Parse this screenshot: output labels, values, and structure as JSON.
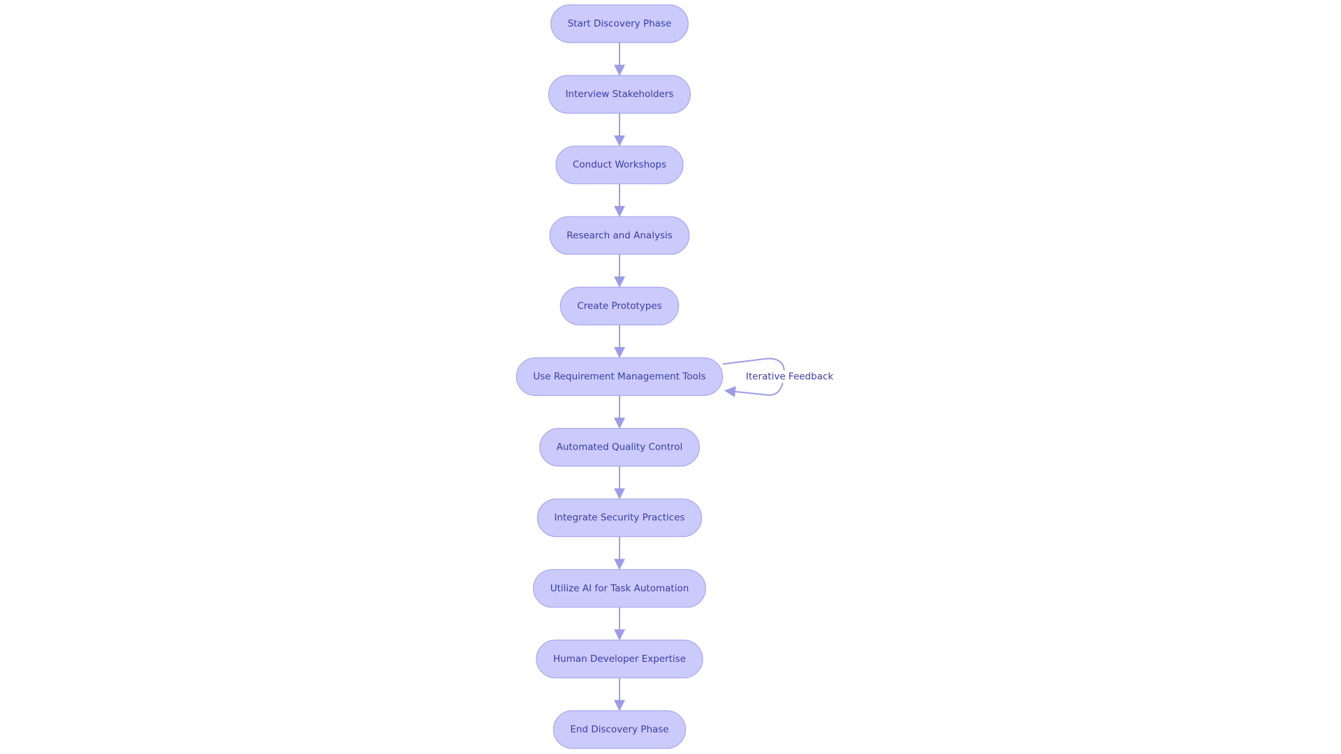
{
  "diagram": {
    "type": "flowchart",
    "direction": "top-down",
    "colors": {
      "node_fill": "#cbcbfb",
      "node_stroke": "#a6a6ee",
      "text": "#3b3ba6",
      "edge": "#9c9ce8"
    },
    "nodes": [
      {
        "id": "start",
        "label": "Start Discovery Phase"
      },
      {
        "id": "interview",
        "label": "Interview Stakeholders"
      },
      {
        "id": "workshops",
        "label": "Conduct Workshops"
      },
      {
        "id": "research",
        "label": "Research and Analysis"
      },
      {
        "id": "prototypes",
        "label": "Create Prototypes"
      },
      {
        "id": "reqtools",
        "label": "Use Requirement Management Tools"
      },
      {
        "id": "qc",
        "label": "Automated Quality Control"
      },
      {
        "id": "security",
        "label": "Integrate Security Practices"
      },
      {
        "id": "ai",
        "label": "Utilize AI for Task Automation"
      },
      {
        "id": "human",
        "label": "Human Developer Expertise"
      },
      {
        "id": "end",
        "label": "End Discovery Phase"
      }
    ],
    "edges": [
      {
        "from": "start",
        "to": "interview",
        "label": ""
      },
      {
        "from": "interview",
        "to": "workshops",
        "label": ""
      },
      {
        "from": "workshops",
        "to": "research",
        "label": ""
      },
      {
        "from": "research",
        "to": "prototypes",
        "label": ""
      },
      {
        "from": "prototypes",
        "to": "reqtools",
        "label": ""
      },
      {
        "from": "reqtools",
        "to": "reqtools",
        "label": "Iterative Feedback"
      },
      {
        "from": "reqtools",
        "to": "qc",
        "label": ""
      },
      {
        "from": "qc",
        "to": "security",
        "label": ""
      },
      {
        "from": "security",
        "to": "ai",
        "label": ""
      },
      {
        "from": "ai",
        "to": "human",
        "label": ""
      },
      {
        "from": "human",
        "to": "end",
        "label": ""
      }
    ]
  }
}
